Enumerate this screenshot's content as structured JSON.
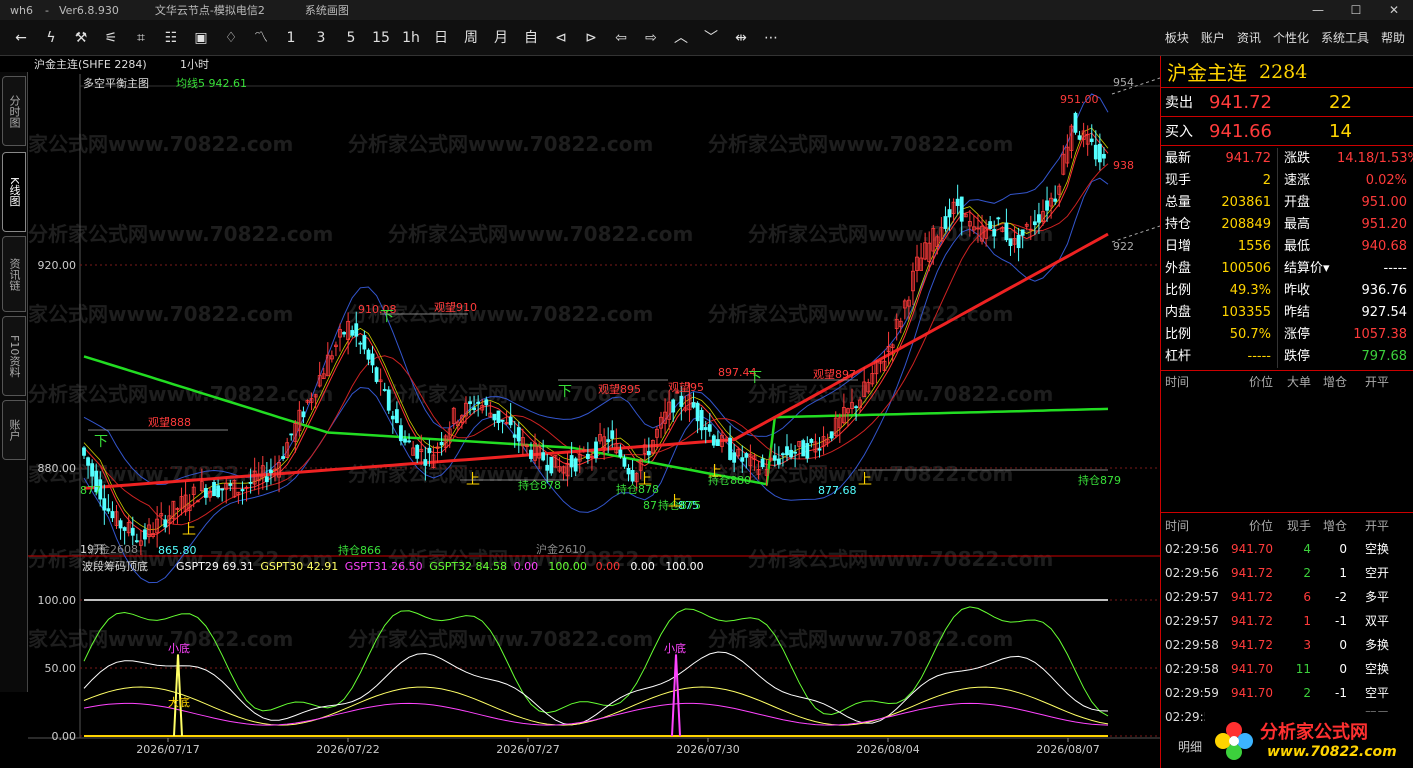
{
  "titlebar": {
    "app": "wh6",
    "version": "Ver6.8.930",
    "server": "文华云节点-模拟电信2",
    "doc": "系统画图",
    "buttons": [
      "—",
      "☐",
      "✕"
    ]
  },
  "toolbar": {
    "icons": [
      "back-icon",
      "forward-icon",
      "draw-icon",
      "indicator-icon",
      "cross-icon",
      "grid-icon",
      "chart-icon",
      "bell-icon",
      "line-chart-icon"
    ],
    "periods": [
      "1",
      "3",
      "5",
      "15",
      "1h",
      "日",
      "周",
      "月",
      "自"
    ],
    "icons2": [
      "prev-bar-icon",
      "next-bar-icon",
      "left-icon",
      "right-icon",
      "zoom-in-icon",
      "zoom-out-icon",
      "cursor-icon",
      "more-icon"
    ],
    "menu": [
      "板块",
      "账户",
      "资讯",
      "个性化",
      "系统工具",
      "帮助"
    ]
  },
  "lefttabs": [
    "分时图",
    "K线图",
    "资讯链",
    "F10资料",
    "账户"
  ],
  "chart": {
    "symbol": "沪金主连(SHFE 2284)",
    "period": "1小时",
    "mainind": "多空平衡主图",
    "ma_label": "均线5 942.61",
    "watermark": "分析家公式网www.70822.com",
    "yaxis": [
      "920.00",
      "880.00"
    ],
    "subyaxis": [
      "100.00",
      "50.00",
      "0.00"
    ],
    "xaxis": [
      "2026/07/17",
      "2026/07/22",
      "2026/07/27",
      "2026/07/30",
      "2026/08/04",
      "2026/08/07"
    ],
    "labels": {
      "hi1": "910.08",
      "hi2": "897.44",
      "hi3": "951.00",
      "lo1": "865.80",
      "lo2": "877.68",
      "lo3": "875",
      "band_top": "954",
      "band_bot": "922",
      "ma_top": "938",
      "lbl877": "877",
      "w1": "观望910",
      "w2": "观望895",
      "w3": "观望897",
      "w4": "观望95",
      "w5": "观望888",
      "h1": "持仓878",
      "h2": "持仓878",
      "h3": "持仓880",
      "h4": "持仓879",
      "h5": "持仓866",
      "h6": "持仓875",
      "h7": "87",
      "up": "上",
      "down": "下",
      "c2608": "沪金2608",
      "c2610": "沪金2610",
      "c19": "19开"
    },
    "sub": {
      "name": "波段筹码顶底",
      "items": [
        {
          "k": "GSPT29",
          "v": "69.31",
          "c": "#ffffff"
        },
        {
          "k": "GSPT30",
          "v": "42.91",
          "c": "#ffff66"
        },
        {
          "k": "GSPT31",
          "v": "26.50",
          "c": "#ff44ff"
        },
        {
          "k": "GSPT32",
          "v": "84.58",
          "c": "#66ff33"
        },
        {
          "k": "",
          "v": "0.00",
          "c": "#ff44ff"
        },
        {
          "k": "",
          "v": "100.00",
          "c": "#66ff33"
        },
        {
          "k": "",
          "v": "0.00",
          "c": "#ff3333"
        },
        {
          "k": "",
          "v": "0.00",
          "c": "#ffffff"
        },
        {
          "k": "",
          "v": "100.00",
          "c": "#ffffff"
        }
      ],
      "small1": "小底",
      "small2": "小底",
      "big": "大底"
    }
  },
  "quote": {
    "name": "沪金主连",
    "code": "2284",
    "sell_lbl": "卖出",
    "sell_px": "941.72",
    "sell_vol": "22",
    "buy_lbl": "买入",
    "buy_px": "941.66",
    "buy_vol": "14",
    "stats": [
      [
        "最新",
        "941.72",
        "涨跌",
        "14.18/1.53%"
      ],
      [
        "现手",
        "2",
        "速涨",
        "0.02%"
      ],
      [
        "总量",
        "203861",
        "开盘",
        "951.00"
      ],
      [
        "持仓",
        "208849",
        "最高",
        "951.20"
      ],
      [
        "日增",
        "1556",
        "最低",
        "940.68"
      ],
      [
        "外盘",
        "100506",
        "结算价▾",
        "-----"
      ],
      [
        "比例",
        "49.3%",
        "昨收",
        "936.76"
      ],
      [
        "内盘",
        "103355",
        "昨结",
        "927.54"
      ],
      [
        "比例",
        "50.7%",
        "涨停",
        "1057.38"
      ],
      [
        "杠杆",
        "-----",
        "跌停",
        "797.68"
      ]
    ],
    "big_hdr": [
      "时间",
      "价位",
      "大单",
      "增仓",
      "开平"
    ],
    "tick_hdr": [
      "时间",
      "价位",
      "现手",
      "增仓",
      "开平"
    ],
    "ticks": [
      [
        "02:29:56",
        "941.70",
        "4",
        "0",
        "空换"
      ],
      [
        "02:29:56",
        "941.72",
        "2",
        "1",
        "空开"
      ],
      [
        "02:29:57",
        "941.72",
        "6",
        "-2",
        "多平"
      ],
      [
        "02:29:57",
        "941.72",
        "1",
        "-1",
        "双平"
      ],
      [
        "02:29:58",
        "941.72",
        "3",
        "0",
        "多换"
      ],
      [
        "02:29:58",
        "941.70",
        "11",
        "0",
        "空换"
      ],
      [
        "02:29:59",
        "941.70",
        "2",
        "-1",
        "空平"
      ],
      [
        "02:29:59",
        "941.72",
        "3",
        "-2",
        "双平"
      ]
    ]
  },
  "logo": {
    "l1": "分析家公式网",
    "l2": "www.70822.com"
  },
  "bottomtab": "明细"
}
